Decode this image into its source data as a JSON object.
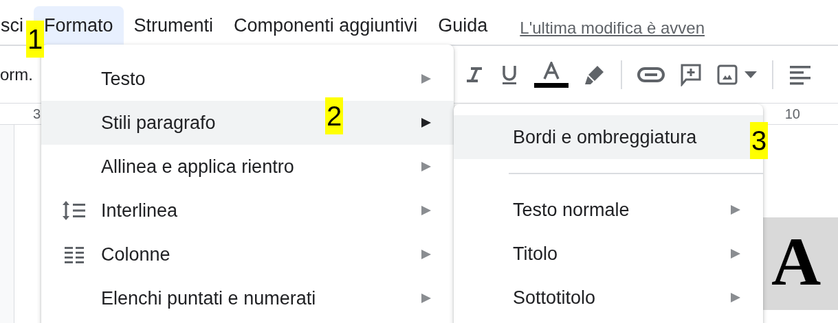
{
  "menubar": {
    "items": [
      {
        "label": "sci",
        "selected": false
      },
      {
        "label": "Formato",
        "selected": true
      },
      {
        "label": "Strumenti",
        "selected": false
      },
      {
        "label": "Componenti aggiuntivi",
        "selected": false
      },
      {
        "label": "Guida",
        "selected": false
      }
    ],
    "last_edit": "L'ultima modifica è avven"
  },
  "toolbar": {
    "style_label": "orm."
  },
  "ruler": {
    "left_mark": "3",
    "right_mark": "10"
  },
  "document": {
    "text": "A"
  },
  "format_menu": {
    "items": [
      {
        "label": "Testo",
        "kind": "plain",
        "selected": false
      },
      {
        "label": "Stili paragrafo",
        "kind": "plain",
        "selected": true
      },
      {
        "label": "Allinea e applica rientro",
        "kind": "plain",
        "selected": false
      },
      {
        "label": "Interlinea",
        "kind": "spacing",
        "selected": false
      },
      {
        "label": "Colonne",
        "kind": "columns",
        "selected": false
      },
      {
        "label": "Elenchi puntati e numerati",
        "kind": "plain",
        "selected": false
      }
    ]
  },
  "styles_submenu": {
    "items": [
      {
        "label": "Bordi e ombreggiatura",
        "kind": "action",
        "selected": true
      },
      {
        "kind": "divider"
      },
      {
        "label": "Testo normale",
        "kind": "submenu",
        "selected": false
      },
      {
        "label": "Titolo",
        "kind": "submenu",
        "selected": false
      },
      {
        "label": "Sottotitolo",
        "kind": "submenu",
        "selected": false
      }
    ]
  },
  "annotations": [
    {
      "label": "1"
    },
    {
      "label": "2"
    },
    {
      "label": "3"
    }
  ]
}
